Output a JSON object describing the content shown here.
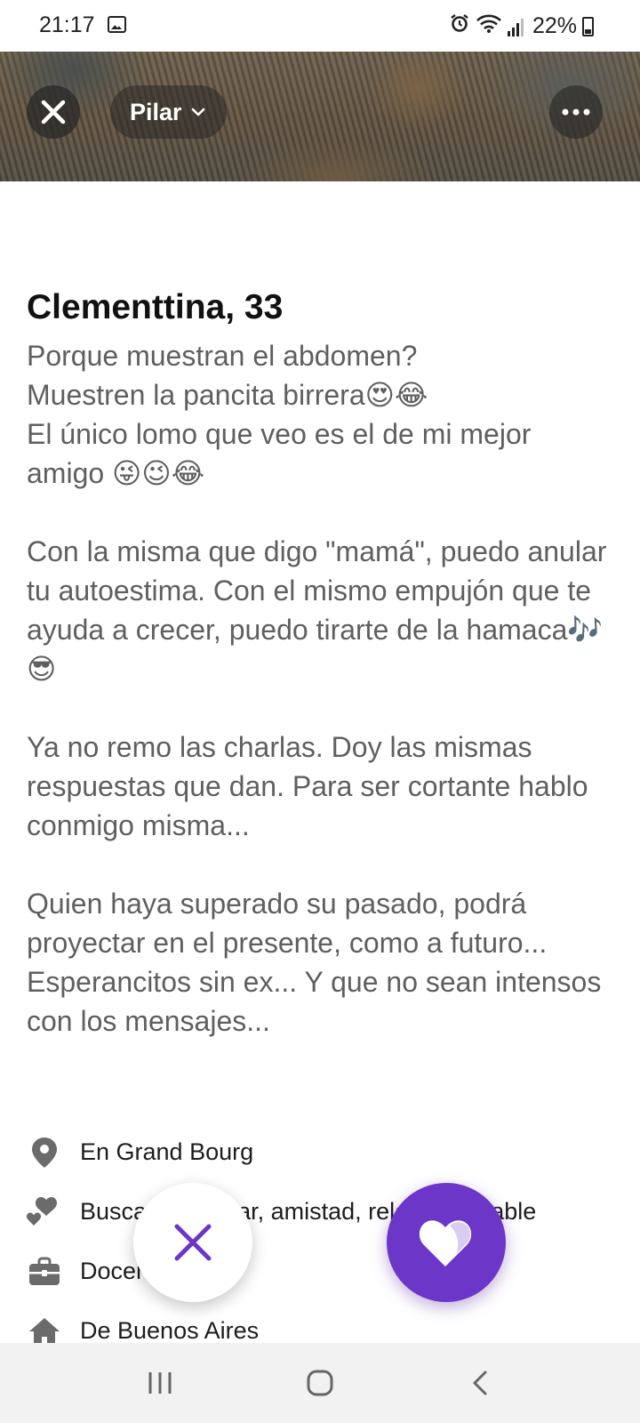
{
  "status_bar": {
    "time": "21:17",
    "battery": "22%",
    "icons": [
      "image-icon",
      "alarm-icon",
      "wifi-icon",
      "signal-icon",
      "battery-icon"
    ]
  },
  "header": {
    "location_label": "Pilar",
    "close_icon": "close-icon",
    "more_icon": "more-icon"
  },
  "profile": {
    "name_age": "Clementtina, 33",
    "bio": [
      "Porque muestran el abdomen?\nMuestren la pancita birrera😍😂\nEl único lomo que veo es el de mi mejor amigo 😜😉😂",
      "Con la misma que digo \"mamá\", puedo anular tu autoestima. Con el mismo empujón que te ayuda a crecer, puedo tirarte de la hamaca🎶😎",
      "Ya no remo las charlas. Doy las mismas respuestas que dan. Para ser cortante hablo conmigo misma...",
      "Quien haya superado su pasado, podrá proyectar en el presente, como a futuro...\nEsperancitos sin ex... Y que no sean intensos con los mensajes..."
    ],
    "details": [
      {
        "icon": "location-pin-icon",
        "text": "En Grand Bourg"
      },
      {
        "icon": "hearts-icon",
        "text": "Busca conversar, amistad, relación estable"
      },
      {
        "icon": "briefcase-icon",
        "text": "Docente"
      },
      {
        "icon": "home-icon",
        "text": "De Buenos Aires"
      }
    ]
  },
  "actions": {
    "pass_icon": "close-icon",
    "like_icon": "heart-icon"
  },
  "nav_bar": {
    "icons": [
      "recent-apps-icon",
      "home-icon",
      "back-icon"
    ]
  },
  "colors": {
    "accent": "#6c36c9",
    "text_primary": "#111111",
    "text_bio": "#5f5f5f",
    "icon_gray": "#6b6b6b"
  }
}
